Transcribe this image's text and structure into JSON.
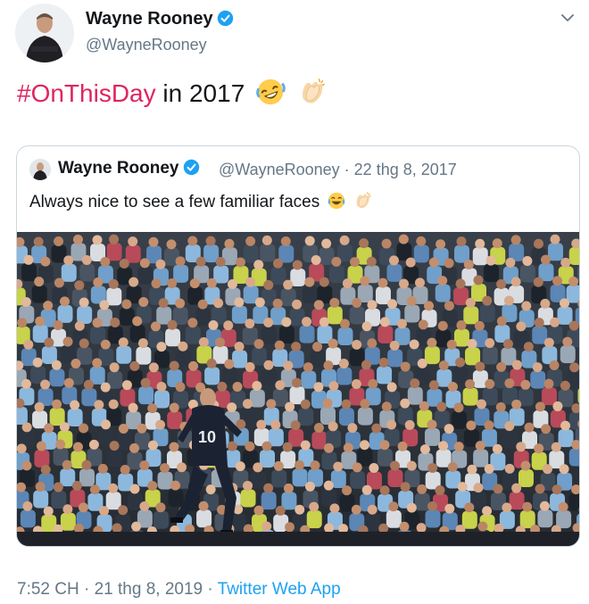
{
  "header": {
    "display_name": "Wayne Rooney",
    "handle": "@WayneRooney",
    "verified_icon": "verified-badge-icon",
    "menu_icon": "chevron-down-icon"
  },
  "tweet": {
    "hashtag": "#OnThisDay",
    "text_rest": " in 2017",
    "emojis": [
      "rolling-on-floor-laughing-emoji",
      "clapping-hands-emoji"
    ]
  },
  "quoted_tweet": {
    "display_name": "Wayne Rooney",
    "handle": "@WayneRooney",
    "separator": " · ",
    "date": "22 thg 8, 2017",
    "text": "Always nice to see a few familiar faces",
    "emojis": [
      "face-with-tears-of-joy-emoji",
      "clapping-hands-emoji"
    ],
    "image": {
      "description_icon": "stadium-crowd-photo",
      "player_number": "10"
    }
  },
  "footer": {
    "time": "7:52 CH",
    "separator": " · ",
    "date": "21 thg 8, 2019",
    "source": "Twitter Web App"
  },
  "colors": {
    "hashtag": "#e0245e",
    "link": "#1da1f2",
    "muted": "#657786",
    "verified": "#1da1f2",
    "border": "#ccd6dd"
  }
}
